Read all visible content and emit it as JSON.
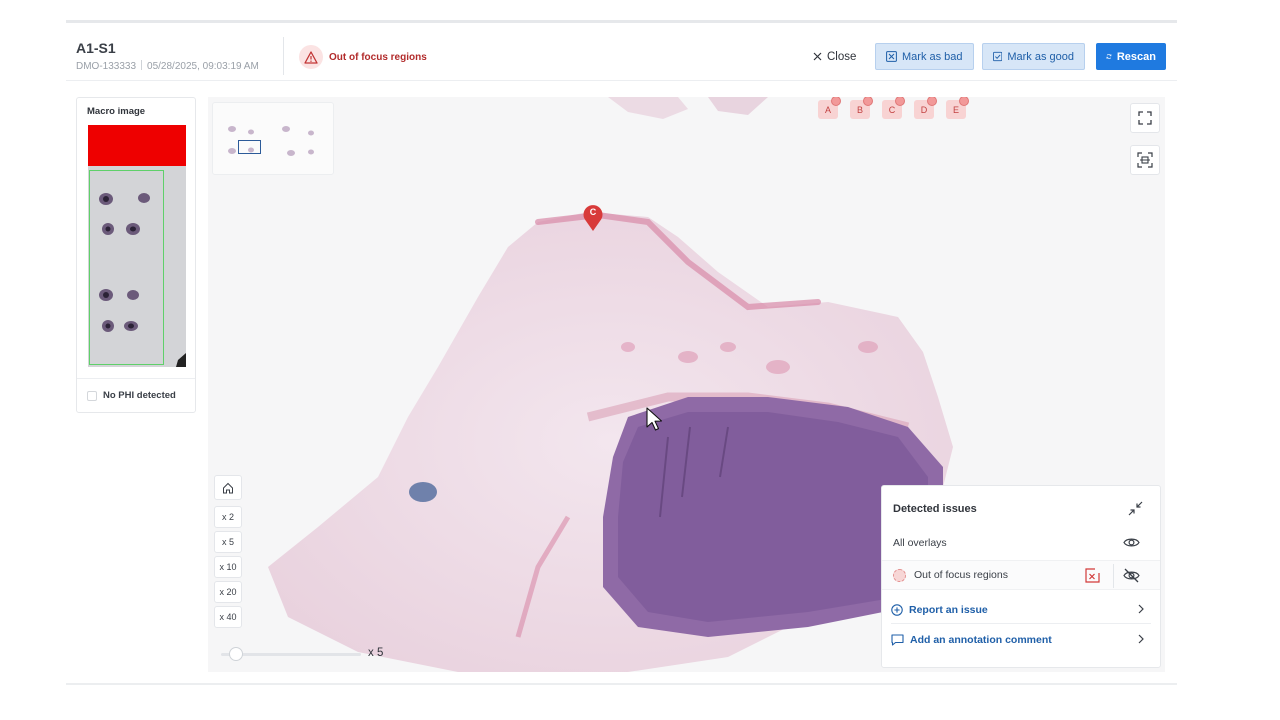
{
  "header": {
    "slide_id": "A1-S1",
    "case_id": "DMO-133333",
    "timestamp": "05/28/2025, 09:03:19 AM",
    "issue_label": "Out of focus regions",
    "close_label": "Close",
    "mark_bad_label": "Mark as bad",
    "mark_good_label": "Mark as good",
    "rescan_label": "Rescan"
  },
  "macro": {
    "title": "Macro image",
    "phi_label": "No PHI detected"
  },
  "viewer": {
    "markers": [
      "A",
      "B",
      "C",
      "D",
      "E"
    ],
    "pin_label": "C",
    "zoom_levels": [
      "x 2",
      "x 5",
      "x 10",
      "x 20",
      "x 40"
    ],
    "current_zoom": "x 5"
  },
  "issues_panel": {
    "title": "Detected issues",
    "all_overlays_label": "All overlays",
    "out_of_focus_label": "Out of focus regions",
    "report_issue_label": "Report an issue",
    "add_comment_label": "Add an annotation comment"
  },
  "colors": {
    "primary": "#1f7ae0",
    "warning": "#b22b2b",
    "marker_bg": "#f8d3d3",
    "slide_label": "#ee0000"
  }
}
